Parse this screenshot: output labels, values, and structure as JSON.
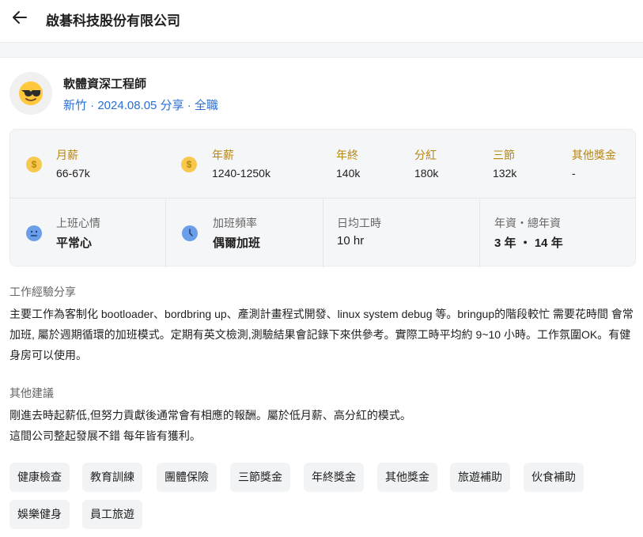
{
  "header": {
    "company": "啟碁科技股份有限公司"
  },
  "post": {
    "title": "軟體資深工程師",
    "meta": "新竹 · 2024.08.05 分享 · 全職"
  },
  "salary": {
    "monthly_label": "月薪",
    "monthly_value": "66-67k",
    "annual_label": "年薪",
    "annual_value": "1240-1250k",
    "yearend_label": "年終",
    "yearend_value": "140k",
    "bonus_label": "分紅",
    "bonus_value": "180k",
    "festival_label": "三節",
    "festival_value": "132k",
    "other_label": "其他獎金",
    "other_value": "-"
  },
  "work": {
    "mood_label": "上班心情",
    "mood_value": "平常心",
    "overtime_label": "加班頻率",
    "overtime_value": "偶爾加班",
    "hours_label": "日均工時",
    "hours_value": "10 hr",
    "seniority_label": "年資・總年資",
    "seniority_value": "3 年 ・ 14 年"
  },
  "experience": {
    "title": "工作經驗分享",
    "body": "主要工作為客制化 bootloader、bordbring up、產測計畫程式開發、linux system debug 等。bringup的階段較忙 需要花時間 會常加班, 屬於週期循環的加班模式。定期有英文檢測,測驗結果會記錄下來供參考。實際工時平均約 9~10 小時。工作氛圍OK。有健身房可以使用。"
  },
  "advice": {
    "title": "其他建議",
    "line1": "剛進去時起薪低,但努力貢獻後通常會有相應的報酬。屬於低月薪、高分紅的模式。",
    "line2": "這間公司整起發展不錯 每年皆有獲利。"
  },
  "tags": [
    "健康檢查",
    "教育訓練",
    "團體保險",
    "三節獎金",
    "年終獎金",
    "其他獎金",
    "旅遊補助",
    "伙食補助",
    "娛樂健身",
    "員工旅遊"
  ],
  "colors": {
    "accent": "#2a6fd6",
    "gold": "#b8860b",
    "coin": "#f6c94e",
    "icon_blue": "#6b9ee8"
  },
  "icons": {
    "back": "arrow-left-icon",
    "avatar": "sunglasses-emoji-icon",
    "money": "dollar-coin-icon",
    "mood": "neutral-face-icon",
    "clock": "clock-icon"
  }
}
